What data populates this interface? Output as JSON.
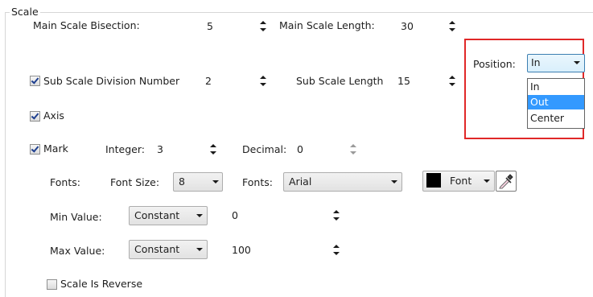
{
  "group": {
    "title": "Scale"
  },
  "main_scale": {
    "bisection_label": "Main Scale Bisection:",
    "bisection_value": "5",
    "length_label": "Main Scale Length:",
    "length_value": "30"
  },
  "sub_scale": {
    "checkbox_label": "Sub Scale Division Number",
    "checked": true,
    "division_value": "2",
    "length_label": "Sub Scale Length",
    "length_value": "15"
  },
  "axis": {
    "label": "Axis",
    "checked": true
  },
  "mark": {
    "label": "Mark",
    "checked": true,
    "integer_label": "Integer:",
    "integer_value": "3",
    "decimal_label": "Decimal:",
    "decimal_value": "0"
  },
  "fonts_row": {
    "label": "Fonts:",
    "size_label": "Font Size:",
    "size_value": "8",
    "fonts_label": "Fonts:",
    "font_value": "Arial",
    "font_color_label": "Font",
    "font_color": "#000000"
  },
  "min_value": {
    "label": "Min Value:",
    "mode": "Constant",
    "value": "0"
  },
  "max_value": {
    "label": "Max Value:",
    "mode": "Constant",
    "value": "100"
  },
  "reverse": {
    "label": "Scale Is Reverse",
    "checked": false
  },
  "position": {
    "label": "Position:",
    "selected": "In",
    "options": [
      "In",
      "Out",
      "Center"
    ],
    "highlighted_option": "Out"
  },
  "colors": {
    "highlight_border": "#e02828",
    "selection": "#3399ff"
  }
}
